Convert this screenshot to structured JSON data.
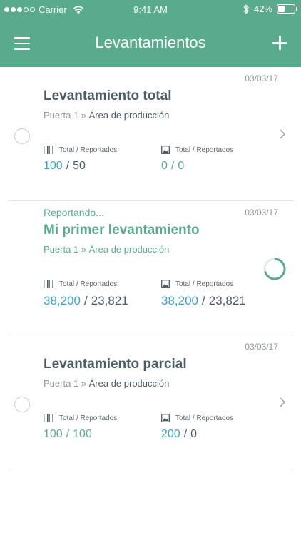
{
  "status_bar": {
    "carrier": "Carrier",
    "time": "9:41 AM",
    "battery": "42%",
    "battery_level": 0.42
  },
  "nav": {
    "title": "Levantamientos"
  },
  "records": [
    {
      "date": "03/03/17",
      "status": "",
      "title": "Levantamiento total",
      "location": "Puerta 1",
      "separator": " » ",
      "area": "Área de producción",
      "stats": [
        {
          "label": "Total / Reportados",
          "icon": "barcode-icon",
          "total": "100",
          "reported": "50"
        },
        {
          "label": "Total / Reportados",
          "icon": "image-icon",
          "total": "0",
          "reported": "0"
        }
      ]
    },
    {
      "date": "03/03/17",
      "status": "Reportando...",
      "title": "Mi primer levantamiento",
      "location": "Puerta 1",
      "separator": " » ",
      "area": "Área de producción",
      "stats": [
        {
          "label": "Total / Reportados",
          "icon": "barcode-icon",
          "total": "38,200",
          "reported": "23,821"
        },
        {
          "label": "Total / Reportados",
          "icon": "image-icon",
          "total": "38,200",
          "reported": "23,821"
        }
      ]
    },
    {
      "date": "03/03/17",
      "status": "",
      "title": "Levantamiento parcial",
      "location": "Puerta 1",
      "separator": " » ",
      "area": "Área de producción",
      "stats": [
        {
          "label": "Total / Reportados",
          "icon": "barcode-icon",
          "total": "100",
          "reported": "100"
        },
        {
          "label": "Total / Reportados",
          "icon": "image-icon",
          "total": "200",
          "reported": "0"
        }
      ]
    }
  ],
  "stat_separator": "/",
  "colors": {
    "brand": "#5aab8e",
    "value_blue": "#3fa0c8",
    "text_dark": "#4d5b68",
    "text_muted": "#8e969c"
  }
}
